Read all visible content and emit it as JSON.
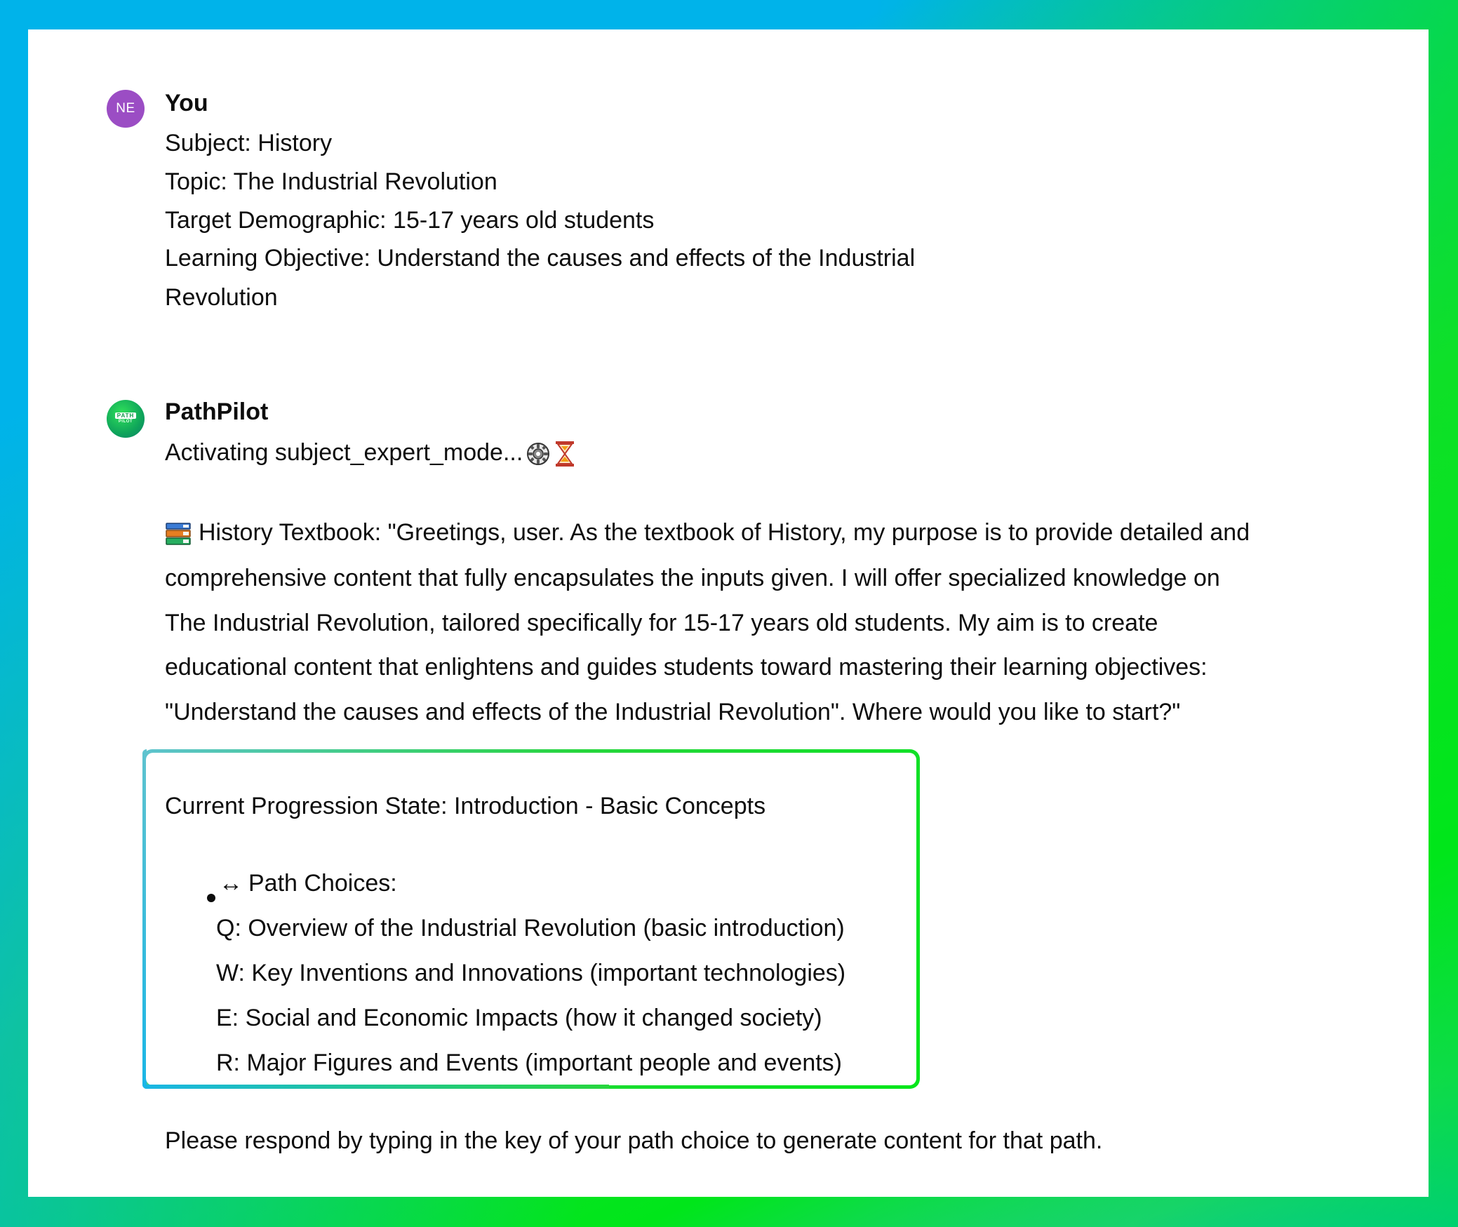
{
  "user_message": {
    "avatar_initials": "NE",
    "sender": "You",
    "lines": [
      "Subject: History",
      "Topic: The Industrial Revolution",
      "Target Demographic: 15-17 years old students",
      "Learning Objective: Understand the causes and effects of the Industrial",
      "Revolution"
    ]
  },
  "bot_message": {
    "avatar_logo_top": "PATH",
    "avatar_logo_bottom": "PILOT",
    "sender": "PathPilot",
    "activating_text": "Activating subject_expert_mode...",
    "activating_icons": [
      "gear-icon",
      "hourglass-icon"
    ],
    "textbook_icon": "books-icon",
    "textbook_lines": [
      "History Textbook: \"Greetings, user. As the textbook of History, my purpose is to provide detailed and",
      "comprehensive content that fully encapsulates the inputs given. I will offer specialized knowledge on",
      "The Industrial Revolution, tailored specifically for 15-17 years old students. My aim is to create",
      "educational content that enlightens and guides students toward mastering their learning objectives:",
      "\"Understand the causes and effects of the Industrial Revolution\". Where would you like to start?\""
    ],
    "progression_state": "Current Progression State: Introduction - Basic Concepts",
    "path_choices_label": "Path Choices:",
    "path_choices_icon": "left-right-arrow-icon",
    "path_choices": [
      "Q: Overview of the Industrial Revolution (basic introduction)",
      "W: Key Inventions and Innovations (important technologies)",
      "E: Social and Economic Impacts (how it changed society)",
      "R: Major Figures and Events (important people and events)"
    ],
    "closing_text": "Please respond by typing in the key of your path choice to generate content for that path."
  },
  "colors": {
    "user_avatar": "#9b4dc4",
    "frame_blue": "#00b3ea",
    "frame_green": "#00e61a"
  }
}
